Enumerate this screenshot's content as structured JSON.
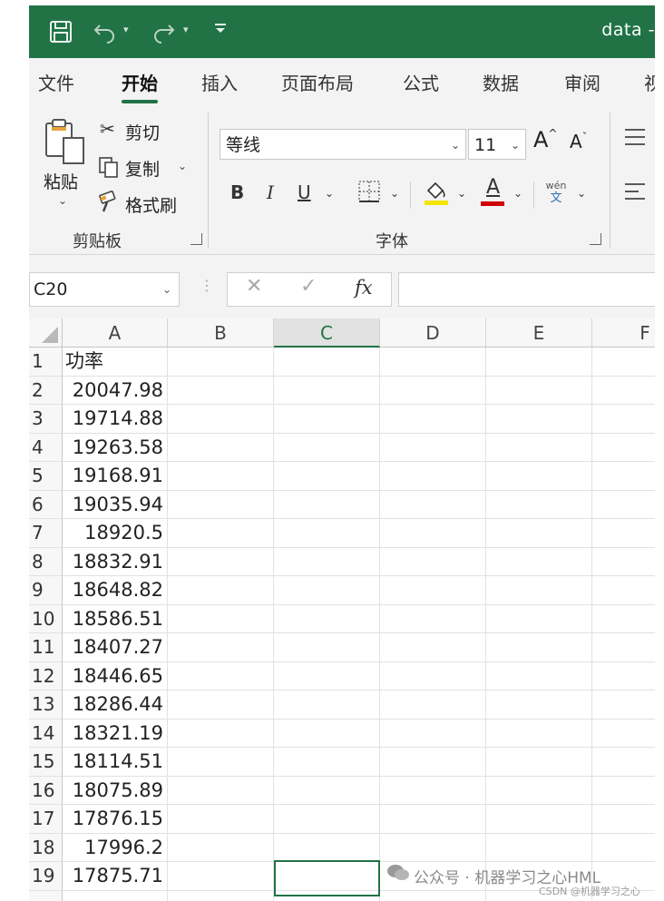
{
  "titlebar": {
    "title": "data -",
    "save_icon": "save-icon",
    "undo_icon": "undo-icon",
    "redo_icon": "redo-icon",
    "qat_caret": "▾"
  },
  "tabs": [
    "文件",
    "开始",
    "插入",
    "页面布局",
    "公式",
    "数据",
    "审阅",
    "视"
  ],
  "active_tab": "开始",
  "clipboard": {
    "paste": "粘贴",
    "cut": "剪切",
    "copy": "复制",
    "format_painter": "格式刷",
    "group_label": "剪贴板"
  },
  "font": {
    "name": "等线",
    "size": "11",
    "group_label": "字体",
    "bold": "B",
    "italic": "I",
    "underline": "U",
    "font_color_letter": "A",
    "phonetic_top": "wén",
    "phonetic_bottom": "文",
    "grow": "A",
    "shrink": "A"
  },
  "colors": {
    "accent": "#217346",
    "highlight": "#f5e400",
    "font_color": "#d00000"
  },
  "formula_bar": {
    "name_box": "C20",
    "cancel": "✕",
    "enter": "✓",
    "fx": "fx",
    "value": ""
  },
  "sheet": {
    "columns": [
      "A",
      "B",
      "C",
      "D",
      "E",
      "F"
    ],
    "selected_column": "C",
    "rows": [
      {
        "n": "1",
        "a": "功率"
      },
      {
        "n": "2",
        "a": "20047.98"
      },
      {
        "n": "3",
        "a": "19714.88"
      },
      {
        "n": "4",
        "a": "19263.58"
      },
      {
        "n": "5",
        "a": "19168.91"
      },
      {
        "n": "6",
        "a": "19035.94"
      },
      {
        "n": "7",
        "a": "18920.5"
      },
      {
        "n": "8",
        "a": "18832.91"
      },
      {
        "n": "9",
        "a": "18648.82"
      },
      {
        "n": "10",
        "a": "18586.51"
      },
      {
        "n": "11",
        "a": "18407.27"
      },
      {
        "n": "12",
        "a": "18446.65"
      },
      {
        "n": "13",
        "a": "18286.44"
      },
      {
        "n": "14",
        "a": "18321.19"
      },
      {
        "n": "15",
        "a": "18114.51"
      },
      {
        "n": "16",
        "a": "18075.89"
      },
      {
        "n": "17",
        "a": "17876.15"
      },
      {
        "n": "18",
        "a": "17996.2"
      },
      {
        "n": "19",
        "a": "17875.71"
      }
    ]
  },
  "watermark": {
    "main": "公众号 · 机器学习之心HML",
    "sub": "CSDN @机器学习之心"
  }
}
